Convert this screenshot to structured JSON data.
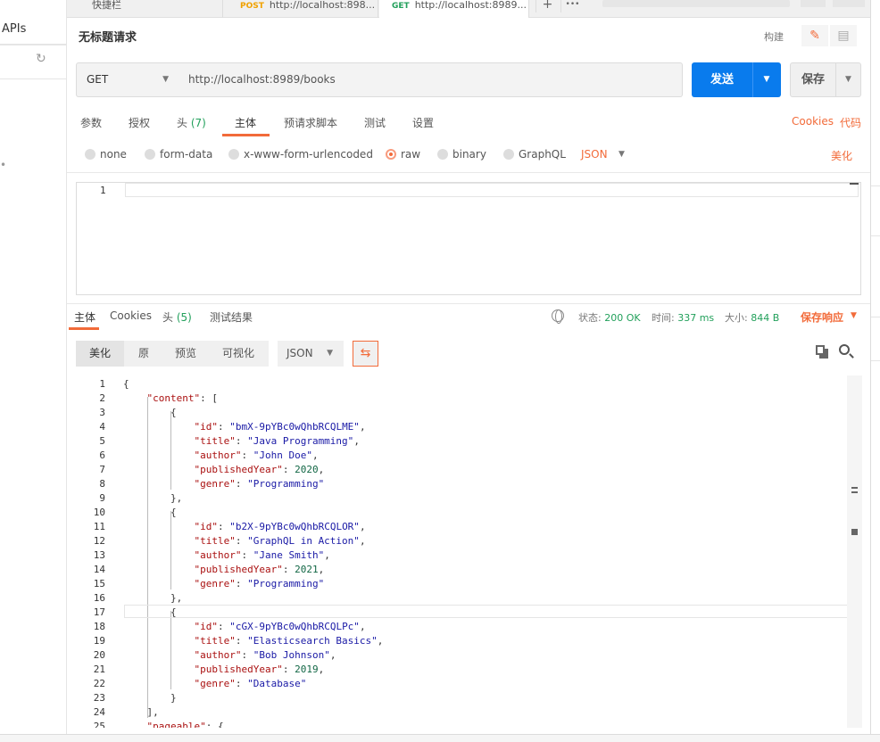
{
  "sidebar": {
    "apis_label": "APIs",
    "refresh_icon": "refresh-icon"
  },
  "tabs": [
    {
      "label": "快捷栏"
    },
    {
      "method": "POST",
      "label": "http://localhost:898...",
      "unsaved": true
    },
    {
      "method": "GET",
      "label": "http://localhost:8989...",
      "unsaved": true,
      "active": true
    }
  ],
  "tab_actions": {
    "add_label": "+",
    "more_label": "•••"
  },
  "request": {
    "title": "无标题请求",
    "build_label": "构建",
    "method": "GET",
    "url": "http://localhost:8989/books",
    "send_label": "发送",
    "save_label": "保存"
  },
  "request_tabs": {
    "params": "参数",
    "auth": "授权",
    "headers": "头",
    "headers_count": "(7)",
    "body": "主体",
    "prerequest": "预请求脚本",
    "tests": "测试",
    "settings": "设置",
    "active": "主体"
  },
  "links": {
    "cookies": "Cookies",
    "code": "代码",
    "beautify": "美化"
  },
  "body_types": {
    "none": "none",
    "form_data": "form-data",
    "urlencoded": "x-www-form-urlencoded",
    "raw": "raw",
    "binary": "binary",
    "graphql": "GraphQL",
    "format": "JSON",
    "selected": "raw"
  },
  "request_editor": {
    "line": "1"
  },
  "response_tabs": {
    "body": "主体",
    "cookies": "Cookies",
    "headers": "头",
    "headers_count": "(5)",
    "test_results": "测试结果"
  },
  "response_status": {
    "status_label": "状态:",
    "status_value": "200 OK",
    "time_label": "时间:",
    "time_value": "337 ms",
    "size_label": "大小:",
    "size_value": "844 B",
    "save_response": "保存响应"
  },
  "response_view": {
    "pretty": "美化",
    "raw": "原",
    "preview": "预览",
    "visualize": "可视化",
    "format": "JSON"
  },
  "response_lines": [
    {
      "n": "1",
      "t": "{"
    },
    {
      "n": "2",
      "t": "    \"content\": ["
    },
    {
      "n": "3",
      "t": "        {"
    },
    {
      "n": "4",
      "t": "            \"id\": \"bmX-9pYBc0wQhbRCQLME\","
    },
    {
      "n": "5",
      "t": "            \"title\": \"Java Programming\","
    },
    {
      "n": "6",
      "t": "            \"author\": \"John Doe\","
    },
    {
      "n": "7",
      "t": "            \"publishedYear\": 2020,"
    },
    {
      "n": "8",
      "t": "            \"genre\": \"Programming\""
    },
    {
      "n": "9",
      "t": "        },"
    },
    {
      "n": "10",
      "t": "        {"
    },
    {
      "n": "11",
      "t": "            \"id\": \"b2X-9pYBc0wQhbRCQLOR\","
    },
    {
      "n": "12",
      "t": "            \"title\": \"GraphQL in Action\","
    },
    {
      "n": "13",
      "t": "            \"author\": \"Jane Smith\","
    },
    {
      "n": "14",
      "t": "            \"publishedYear\": 2021,"
    },
    {
      "n": "15",
      "t": "            \"genre\": \"Programming\""
    },
    {
      "n": "16",
      "t": "        },"
    },
    {
      "n": "17",
      "t": "        {"
    },
    {
      "n": "18",
      "t": "            \"id\": \"cGX-9pYBc0wQhbRCQLPc\","
    },
    {
      "n": "19",
      "t": "            \"title\": \"Elasticsearch Basics\","
    },
    {
      "n": "20",
      "t": "            \"author\": \"Bob Johnson\","
    },
    {
      "n": "21",
      "t": "            \"publishedYear\": 2019,"
    },
    {
      "n": "22",
      "t": "            \"genre\": \"Database\""
    },
    {
      "n": "23",
      "t": "        }"
    },
    {
      "n": "24",
      "t": "    ],"
    },
    {
      "n": "25",
      "t": "    \"pageable\": {"
    }
  ],
  "colors": {
    "accent": "#f26b3a",
    "primary": "#097bed",
    "success": "#22a05b"
  }
}
